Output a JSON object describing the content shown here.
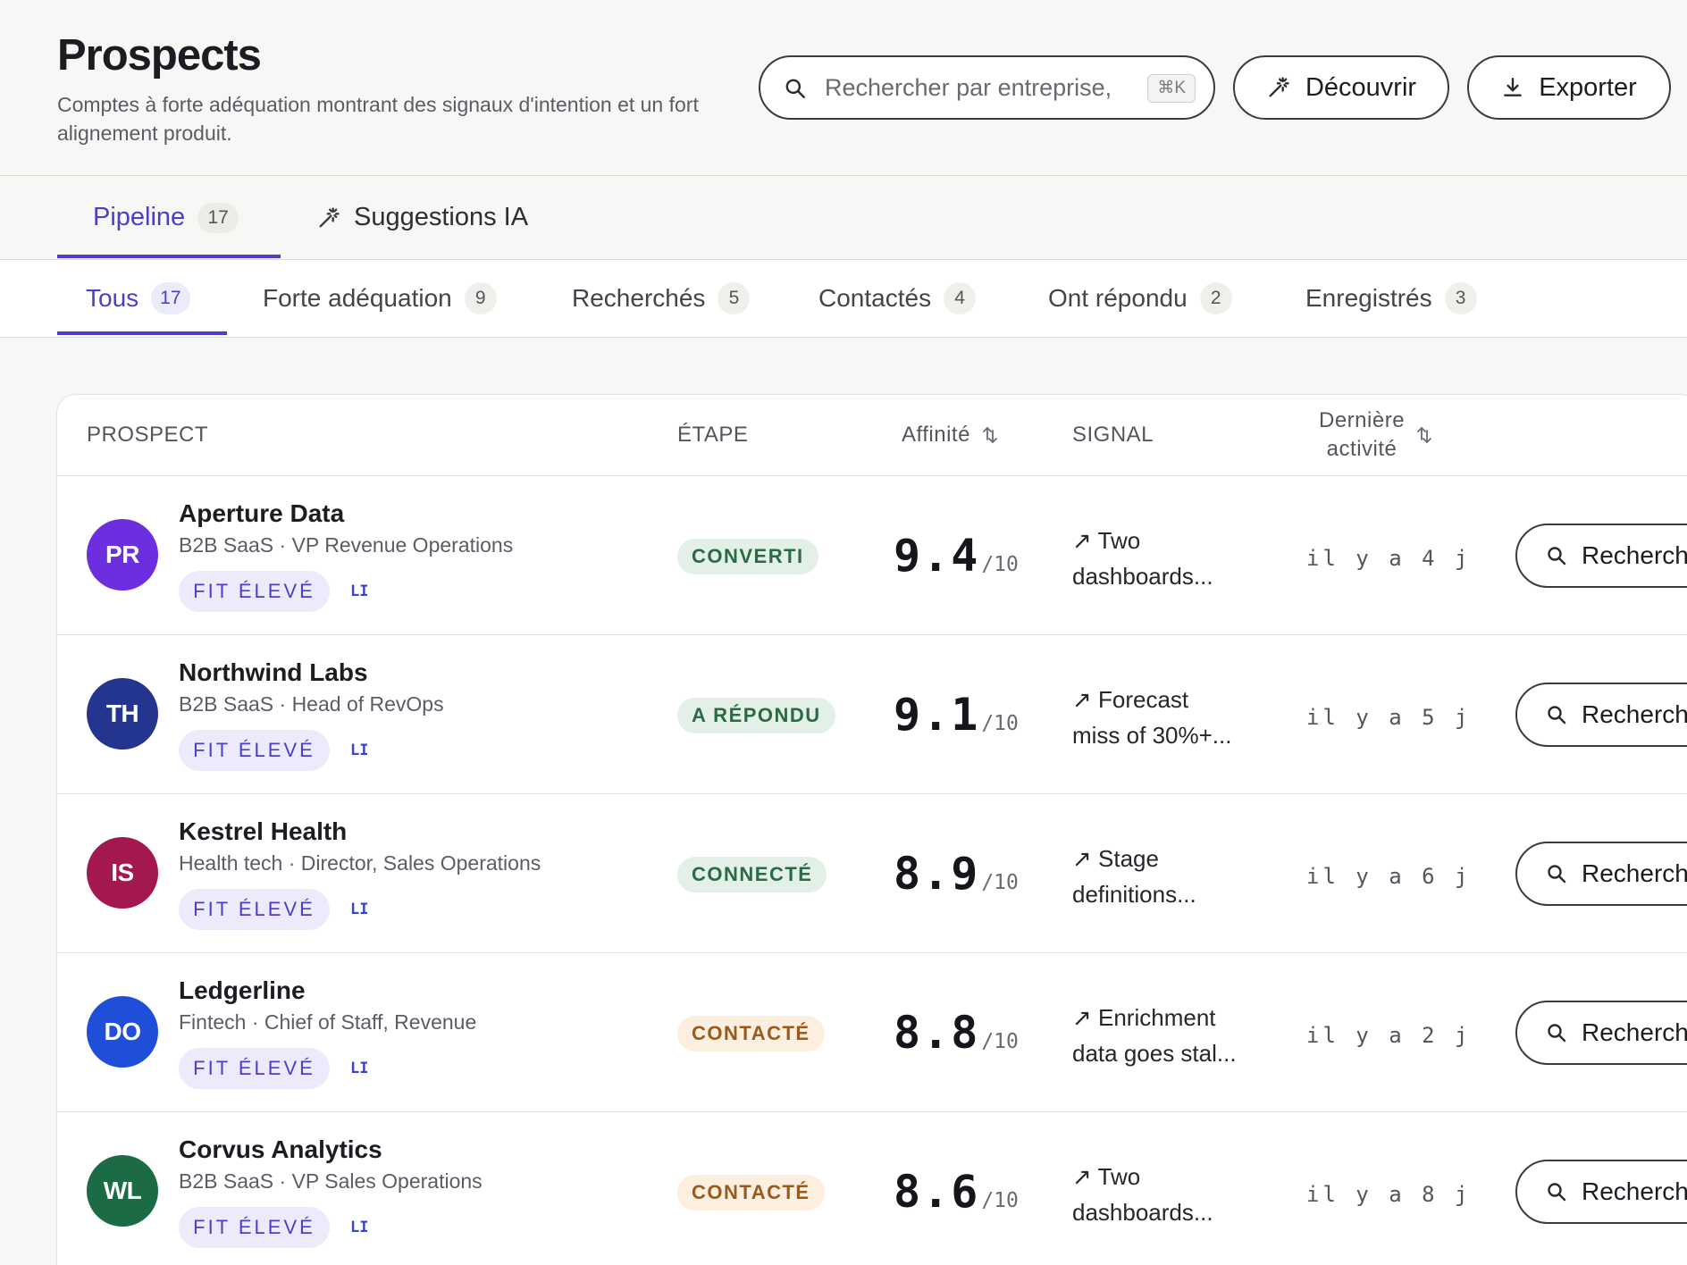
{
  "header": {
    "title": "Prospects",
    "subtitle": "Comptes à forte adéquation montrant des signaux d'intention et un fort alignement produit.",
    "search_placeholder": "Rechercher par entreprise,",
    "search_shortcut": "⌘K",
    "discover_label": "Découvrir",
    "export_label": "Exporter"
  },
  "main_tabs": [
    {
      "label": "Pipeline",
      "count": "17",
      "active": true
    },
    {
      "label": "Suggestions IA",
      "count": "",
      "active": false
    }
  ],
  "filter_tabs": [
    {
      "label": "Tous",
      "count": "17",
      "active": true
    },
    {
      "label": "Forte adéquation",
      "count": "9"
    },
    {
      "label": "Recherchés",
      "count": "5"
    },
    {
      "label": "Contactés",
      "count": "4"
    },
    {
      "label": "Ont répondu",
      "count": "2"
    },
    {
      "label": "Enregistrés",
      "count": "3"
    }
  ],
  "table": {
    "headers": {
      "prospect": "PROSPECT",
      "stage": "ÉTAPE",
      "affinity": "Affinité",
      "signal": "SIGNAL",
      "activity_line1": "Dernière",
      "activity_line2": "activité"
    },
    "score_suffix": "/10",
    "fit_label": "FIT ÉLEVÉ",
    "li_label": "LI",
    "action_label": "Recherch",
    "rows": [
      {
        "initials": "PR",
        "avatar_color": "#6d2ee0",
        "name": "Aperture Data",
        "meta": "B2B SaaS · VP Revenue Operations",
        "stage": "CONVERTI",
        "stage_tone": "green",
        "score": "9.4",
        "signal_line1": "↗ Two",
        "signal_line2": "dashboards...",
        "activity": "il y a 4 j"
      },
      {
        "initials": "TH",
        "avatar_color": "#24358f",
        "name": "Northwind Labs",
        "meta": "B2B SaaS · Head of RevOps",
        "stage": "A RÉPONDU",
        "stage_tone": "green",
        "score": "9.1",
        "signal_line1": "↗ Forecast",
        "signal_line2": "miss of 30%+...",
        "activity": "il y a 5 j"
      },
      {
        "initials": "IS",
        "avatar_color": "#a3184f",
        "name": "Kestrel Health",
        "meta": "Health tech · Director, Sales Operations",
        "stage": "CONNECTÉ",
        "stage_tone": "green",
        "score": "8.9",
        "signal_line1": "↗ Stage",
        "signal_line2": "definitions...",
        "activity": "il y a 6 j"
      },
      {
        "initials": "DO",
        "avatar_color": "#1f4fd8",
        "name": "Ledgerline",
        "meta": "Fintech · Chief of Staff, Revenue",
        "stage": "CONTACTÉ",
        "stage_tone": "amber",
        "score": "8.8",
        "signal_line1": "↗ Enrichment",
        "signal_line2": "data goes stal...",
        "activity": "il y a 2 j"
      },
      {
        "initials": "WL",
        "avatar_color": "#1b6b45",
        "name": "Corvus Analytics",
        "meta": "B2B SaaS · VP Sales Operations",
        "stage": "CONTACTÉ",
        "stage_tone": "amber",
        "score": "8.6",
        "signal_line1": "↗ Two",
        "signal_line2": "dashboards...",
        "activity": "il y a 8 j"
      }
    ]
  },
  "icons": {
    "search": "search-icon",
    "discover": "magic-wand-icon",
    "export": "download-icon",
    "sort": "sort-icon"
  }
}
